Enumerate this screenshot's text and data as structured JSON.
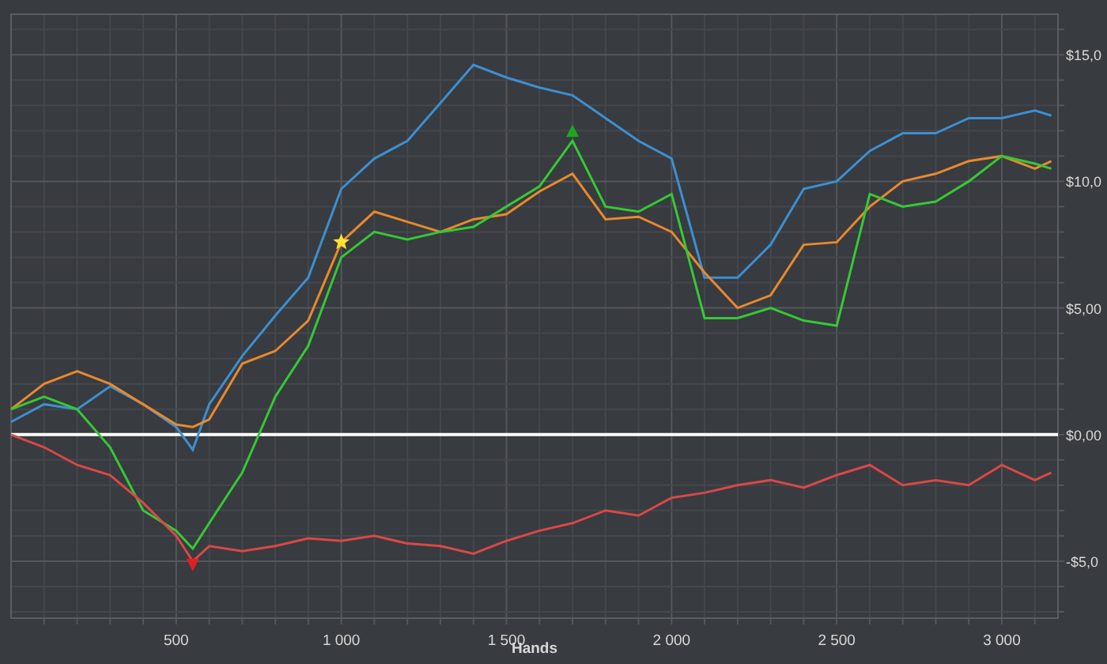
{
  "chart_data": {
    "type": "line",
    "xlabel": "Hands",
    "x": [
      0,
      100,
      200,
      300,
      400,
      500,
      550,
      600,
      700,
      800,
      900,
      1000,
      1100,
      1200,
      1300,
      1400,
      1500,
      1600,
      1700,
      1800,
      1900,
      2000,
      2100,
      2200,
      2300,
      2400,
      2500,
      2600,
      2700,
      2800,
      2900,
      3000,
      3100,
      3150
    ],
    "series": [
      {
        "color": "#3d8fd1",
        "values": [
          0.5,
          1.2,
          1.0,
          1.9,
          1.2,
          0.3,
          -0.6,
          1.2,
          3.1,
          4.7,
          6.2,
          9.7,
          10.9,
          11.6,
          13.1,
          14.6,
          14.1,
          13.7,
          13.4,
          12.5,
          11.6,
          10.9,
          6.2,
          6.2,
          7.5,
          9.7,
          10.0,
          11.2,
          11.9,
          11.9,
          12.5,
          12.5,
          12.8,
          12.6
        ]
      },
      {
        "color": "#e8892e",
        "values": [
          1.0,
          2.0,
          2.5,
          2.0,
          1.2,
          0.4,
          0.3,
          0.6,
          2.8,
          3.3,
          4.5,
          7.6,
          8.8,
          8.4,
          8.0,
          8.5,
          8.7,
          9.6,
          10.3,
          8.5,
          8.6,
          8.0,
          6.4,
          5.0,
          5.5,
          7.5,
          7.6,
          9.0,
          10.0,
          10.3,
          10.8,
          11.0,
          10.5,
          10.8
        ]
      },
      {
        "color": "#35c935",
        "values": [
          1.0,
          1.5,
          1.0,
          -0.5,
          -3.0,
          -3.8,
          -4.5,
          -3.5,
          -1.5,
          1.5,
          3.5,
          7.0,
          8.0,
          7.7,
          8.0,
          8.2,
          9.0,
          9.8,
          11.6,
          9.0,
          8.8,
          9.5,
          4.6,
          4.6,
          5.0,
          4.5,
          4.3,
          9.5,
          9.0,
          9.2,
          10.0,
          11.0,
          10.7,
          10.5
        ]
      },
      {
        "color": "#d94848",
        "values": [
          0,
          -0.5,
          -1.2,
          -1.6,
          -2.7,
          -4.0,
          -5.0,
          -4.4,
          -4.6,
          -4.4,
          -4.1,
          -4.2,
          -4.0,
          -4.3,
          -4.4,
          -4.7,
          -4.2,
          -3.8,
          -3.5,
          -3.0,
          -3.2,
          -2.5,
          -2.3,
          -2.0,
          -1.8,
          -2.1,
          -1.6,
          -1.2,
          -2.0,
          -1.8,
          -2.0,
          -1.2,
          -1.8,
          -1.5
        ]
      }
    ],
    "xlim": [
      0,
      3170
    ],
    "ylim": [
      -7.25,
      16.6
    ],
    "xticks": [
      {
        "value": 500,
        "label": "500"
      },
      {
        "value": 1000,
        "label": "1 000"
      },
      {
        "value": 1500,
        "label": "1 500"
      },
      {
        "value": 2000,
        "label": "2 000"
      },
      {
        "value": 2500,
        "label": "2 500"
      },
      {
        "value": 3000,
        "label": "3 000"
      }
    ],
    "yticks": [
      {
        "value": 15,
        "label": "$15,0"
      },
      {
        "value": 10,
        "label": "$10,0"
      },
      {
        "value": 5,
        "label": "$5,00"
      },
      {
        "value": 0,
        "label": "$0,00"
      },
      {
        "value": -5,
        "label": "-$5,0"
      }
    ],
    "grid": true
  }
}
